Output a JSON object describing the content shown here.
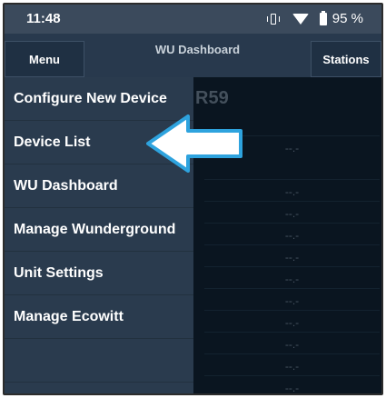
{
  "status_bar": {
    "time": "11:48",
    "battery": "95 %"
  },
  "app_bar": {
    "menu_label": "Menu",
    "title": "WU Dashboard",
    "stations_label": "Stations"
  },
  "content": {
    "title": "R59",
    "placeholder": "--.-"
  },
  "drawer": {
    "items": [
      {
        "label": "Configure New Device"
      },
      {
        "label": "Device List"
      },
      {
        "label": "WU Dashboard"
      },
      {
        "label": "Manage Wunderground"
      },
      {
        "label": "Unit Settings"
      },
      {
        "label": "Manage Ecowitt"
      }
    ]
  },
  "colors": {
    "accent_arrow": "#2ea3de",
    "drawer_bg": "#2a3b4e",
    "appbar_bg": "#28394d"
  }
}
